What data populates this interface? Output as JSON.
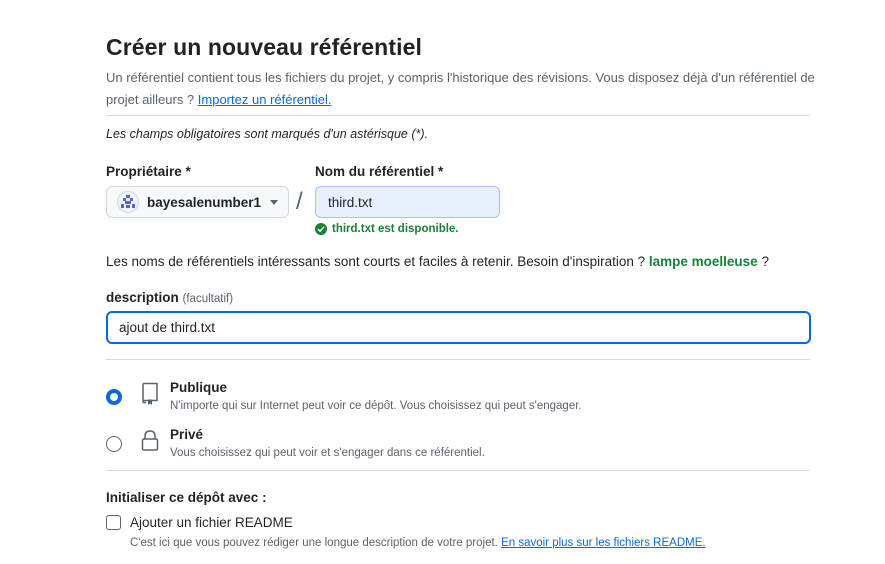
{
  "page": {
    "title": "Créer un nouveau référentiel",
    "intro_text": "Un référentiel contient tous les fichiers du projet, y compris l'historique des révisions. Vous disposez déjà d'un référentiel de projet ailleurs ? ",
    "import_link": "Importez un référentiel.",
    "required_note": "Les champs obligatoires sont marqués d'un astérisque (*)."
  },
  "owner": {
    "label": "Propriétaire *",
    "value": "bayesalenumber1",
    "icon": "identicon-avatar"
  },
  "repo_name": {
    "label": "Nom du référentiel *",
    "value": "third.txt",
    "availability": "third.txt est disponible.",
    "separator": "/"
  },
  "inspiration": {
    "text": "Les noms de référentiels intéressants sont courts et faciles à retenir. Besoin d'inspiration ? ",
    "suggestion": "lampe moelleuse",
    "suffix": " ?"
  },
  "description": {
    "label": "description",
    "optional": "(facultatif)",
    "value": "ajout de third.txt"
  },
  "visibility": {
    "public": {
      "title": "Publique",
      "desc": "N'importe qui sur Internet peut voir ce dépôt. Vous choisissez qui peut s'engager.",
      "selected": true,
      "icon": "repo-icon"
    },
    "private": {
      "title": "Privé",
      "desc": "Vous choisissez qui peut voir et s'engager dans ce référentiel.",
      "selected": false,
      "icon": "lock-icon"
    }
  },
  "initialize": {
    "heading": "Initialiser ce dépôt avec :",
    "readme_label": "Ajouter un fichier README",
    "readme_desc": "C'est ici que vous pouvez rédiger une longue description de votre projet. ",
    "readme_link": "En savoir plus sur les fichiers README.",
    "readme_checked": false
  },
  "colors": {
    "accent": "#0969da",
    "success": "#1a7f37",
    "muted": "#59636e"
  }
}
